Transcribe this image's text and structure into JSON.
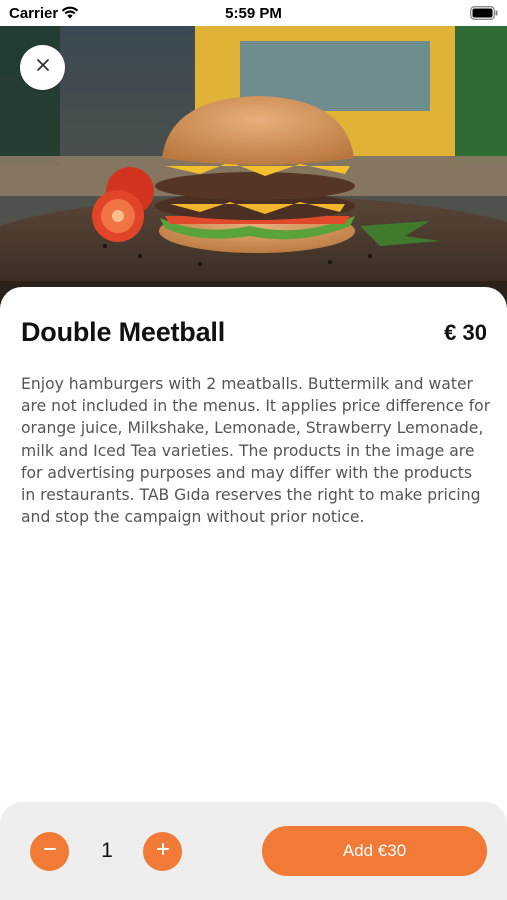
{
  "status_bar": {
    "carrier": "Carrier",
    "time": "5:59 PM"
  },
  "hero": {
    "image_subject": "double patty burger on wooden board"
  },
  "product": {
    "name": "Double Meetball",
    "price": "€ 30",
    "description": "Enjoy hamburgers with 2 meatballs. Buttermilk and water are not included in the menus. It applies price difference for orange juice, Milkshake, Lemonade, Strawberry Lemonade, milk and Iced Tea varieties. The products in the image are for advertising purposes and may differ with the products in restaurants. TAB Gıda reserves the right to make pricing and stop the campaign without prior notice."
  },
  "cart": {
    "quantity": "1",
    "add_label": "Add €30"
  },
  "icons": {
    "close": "close-icon",
    "minus": "minus-icon",
    "plus": "plus-icon",
    "wifi": "wifi-icon",
    "battery": "battery-icon"
  },
  "colors": {
    "accent": "#f07a36",
    "bottom_bar": "#eeeeee",
    "description_text": "#555555"
  }
}
